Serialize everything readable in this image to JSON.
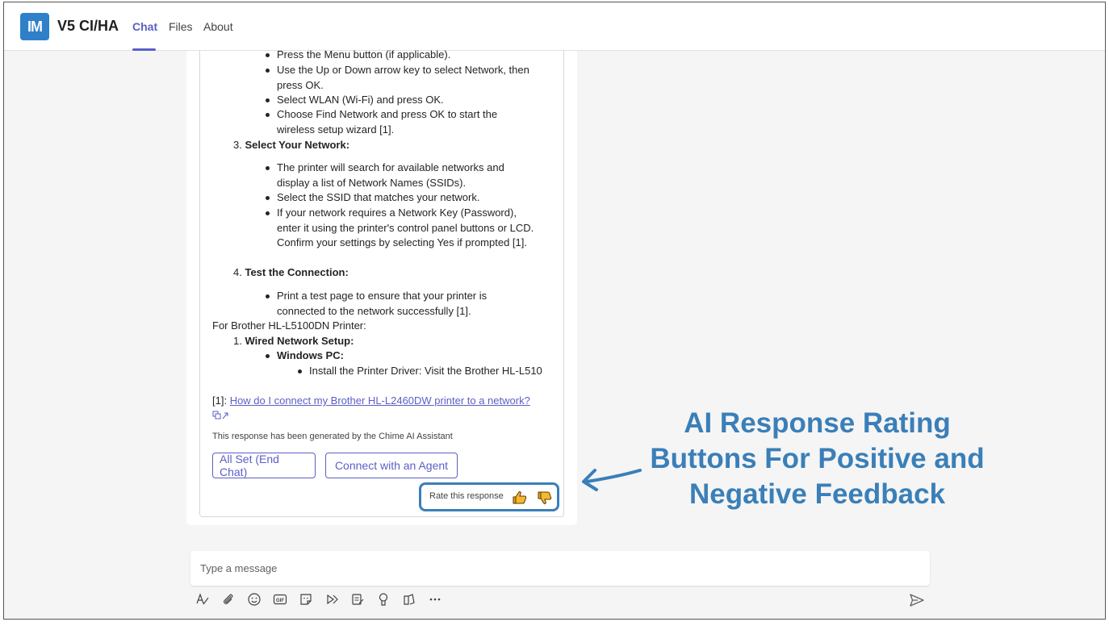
{
  "app": {
    "logo": "IM",
    "title": "V5 CI/HA"
  },
  "tabs": [
    {
      "label": "Chat"
    },
    {
      "label": "Files"
    },
    {
      "label": "About"
    }
  ],
  "message": {
    "bullets_step2": [
      "Press the Menu button (if applicable).",
      "Use the Up or Down arrow key to select Network, then press OK.",
      "Select WLAN (Wi-Fi) and press OK.",
      "Choose Find Network and press OK to start the wireless setup wizard [1]."
    ],
    "step3_label": "3. ",
    "step3_title": "Select Your Network:",
    "bullets_step3": [
      "The printer will search for available networks and display a list of Network Names (SSIDs).",
      "Select the SSID that matches your network.",
      "If your network requires a Network Key (Password), enter it using the printer's control panel buttons or LCD. Confirm your settings by selecting Yes if prompted [1]."
    ],
    "step4_label": "4. ",
    "step4_title": "Test the Connection:",
    "bullets_step4": [
      "Print a test page to ensure that your printer is connected to the network successfully [1]."
    ],
    "brother_heading": "For Brother HL-L5100DN Printer:",
    "wired_label": "1. ",
    "wired_title": "Wired Network Setup:",
    "windows_title": "Windows PC:",
    "install_text": "Install the Printer Driver: Visit the Brother HL-L510",
    "ref_prefix": "[1]: ",
    "ref_link": "How do I connect my Brother HL-L2460DW printer to a network?",
    "disclaimer": "This response has been generated by the Chime AI Assistant",
    "buttons": {
      "end_chat": "All Set (End Chat)",
      "agent": "Connect with an Agent"
    },
    "rate_label": "Rate this response"
  },
  "annotation": {
    "lines": [
      "AI Response Rating",
      "Buttons For Positive and",
      "Negative Feedback"
    ],
    "color": "#3a7fb8"
  },
  "composer": {
    "placeholder": "Type a message"
  },
  "toolbar_icons": [
    "format-icon",
    "attach-icon",
    "emoji-icon",
    "gif-icon",
    "sticker-icon",
    "schedule-icon",
    "loop-icon",
    "praise-icon",
    "apps-icon",
    "more-icon"
  ],
  "colors": {
    "accent": "#5b5fc7",
    "logo_bg": "#2f80c8",
    "thumbs": "#e8a21a"
  }
}
